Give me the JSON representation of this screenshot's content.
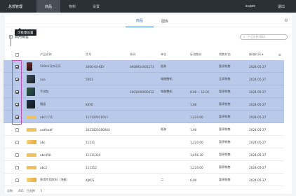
{
  "topbar": {
    "brand": "总部管理",
    "nav": [
      {
        "label": "商品",
        "active": true
      },
      {
        "label": "物料",
        "active": false
      },
      {
        "label": "设置",
        "active": false
      }
    ],
    "store": "super",
    "logout": "退出"
  },
  "tabs": [
    {
      "label": "商品",
      "active": true
    },
    {
      "label": "图库",
      "active": false
    }
  ],
  "toolbar": {
    "bulk_action": "启用销售",
    "search_placeholder": "产品名称/条码"
  },
  "tooltip": "可批量设置",
  "table": {
    "columns": [
      "产品名称",
      "货号",
      "条码",
      "单位",
      "标准售价",
      "销售状态",
      "修改时间"
    ],
    "rows": [
      {
        "selected": true,
        "thumb": "bottle",
        "name": "500ml可口可乐",
        "sku": "3000-6X-KEY",
        "barcode": "6908954001173",
        "unit": "瓶装",
        "price": "",
        "status": "暂停销售",
        "time": "2024-05-27"
      },
      {
        "selected": true,
        "thumb": "dark",
        "name": "aaa",
        "sku": "5003",
        "barcode": "",
        "unit": "电脑整机",
        "price": "",
        "status": "正常销售",
        "time": "2024-05-27"
      },
      {
        "selected": true,
        "thumb": "game",
        "name": "手游包",
        "sku": "",
        "barcode": "1001000000212",
        "unit": "电脑整机",
        "price": "8.00 ~ 12.00",
        "status": "暂停销售",
        "time": "2024-05-27"
      },
      {
        "selected": true,
        "thumb": "screen",
        "name": "镜面",
        "sku": "KKYO",
        "barcode": "",
        "unit": "",
        "price": "1.00",
        "status": "暂停销售",
        "time": "2024-05-27"
      },
      {
        "selected": true,
        "thumb": "gold",
        "name": "abc1111",
        "sku": "111120011013",
        "barcode": "",
        "unit": "",
        "price": "1,224.00",
        "status": "暂停销售",
        "time": "2024-05-27"
      },
      {
        "selected": false,
        "thumb": "gold",
        "name": "asdfsadf",
        "sku": "3021020180004",
        "barcode": "",
        "unit": "瓶装",
        "price": "1.00",
        "status": "暂停销售",
        "time": "2024-05-27"
      },
      {
        "selected": false,
        "thumb": "gold2",
        "name": "abc",
        "sku": "11111",
        "barcode": "",
        "unit": "",
        "price": "1,224.00",
        "status": "暂停销售",
        "time": "2024-05-27"
      },
      {
        "selected": false,
        "thumb": "gold",
        "name": "abc456",
        "sku": "11111334",
        "barcode": "",
        "unit": "",
        "price": "1,456.30",
        "status": "暂停销售",
        "time": "2024-05-27"
      },
      {
        "selected": false,
        "thumb": "gold",
        "name": "abc2",
        "sku": "111112",
        "barcode": "",
        "unit": "",
        "price": "1,224.00",
        "status": "暂停销售",
        "time": "2024-05-27"
      },
      {
        "selected": false,
        "thumb": "gold2",
        "name": "养用专用饮料（泡瓶）",
        "sku": "XJKCS",
        "barcode": "",
        "unit": "二",
        "price": "6.00",
        "status": "暂停销售",
        "time": "2024-05-27"
      }
    ]
  },
  "footer": {
    "total_label": "总数：",
    "total": "445",
    "selected_label": "已选择：",
    "selected": "5"
  },
  "colors": {
    "topbar": "#2b2f36",
    "accent": "#2f6fd6",
    "selected_row": "#b8c9ea",
    "annotation": "#c64bb8"
  }
}
